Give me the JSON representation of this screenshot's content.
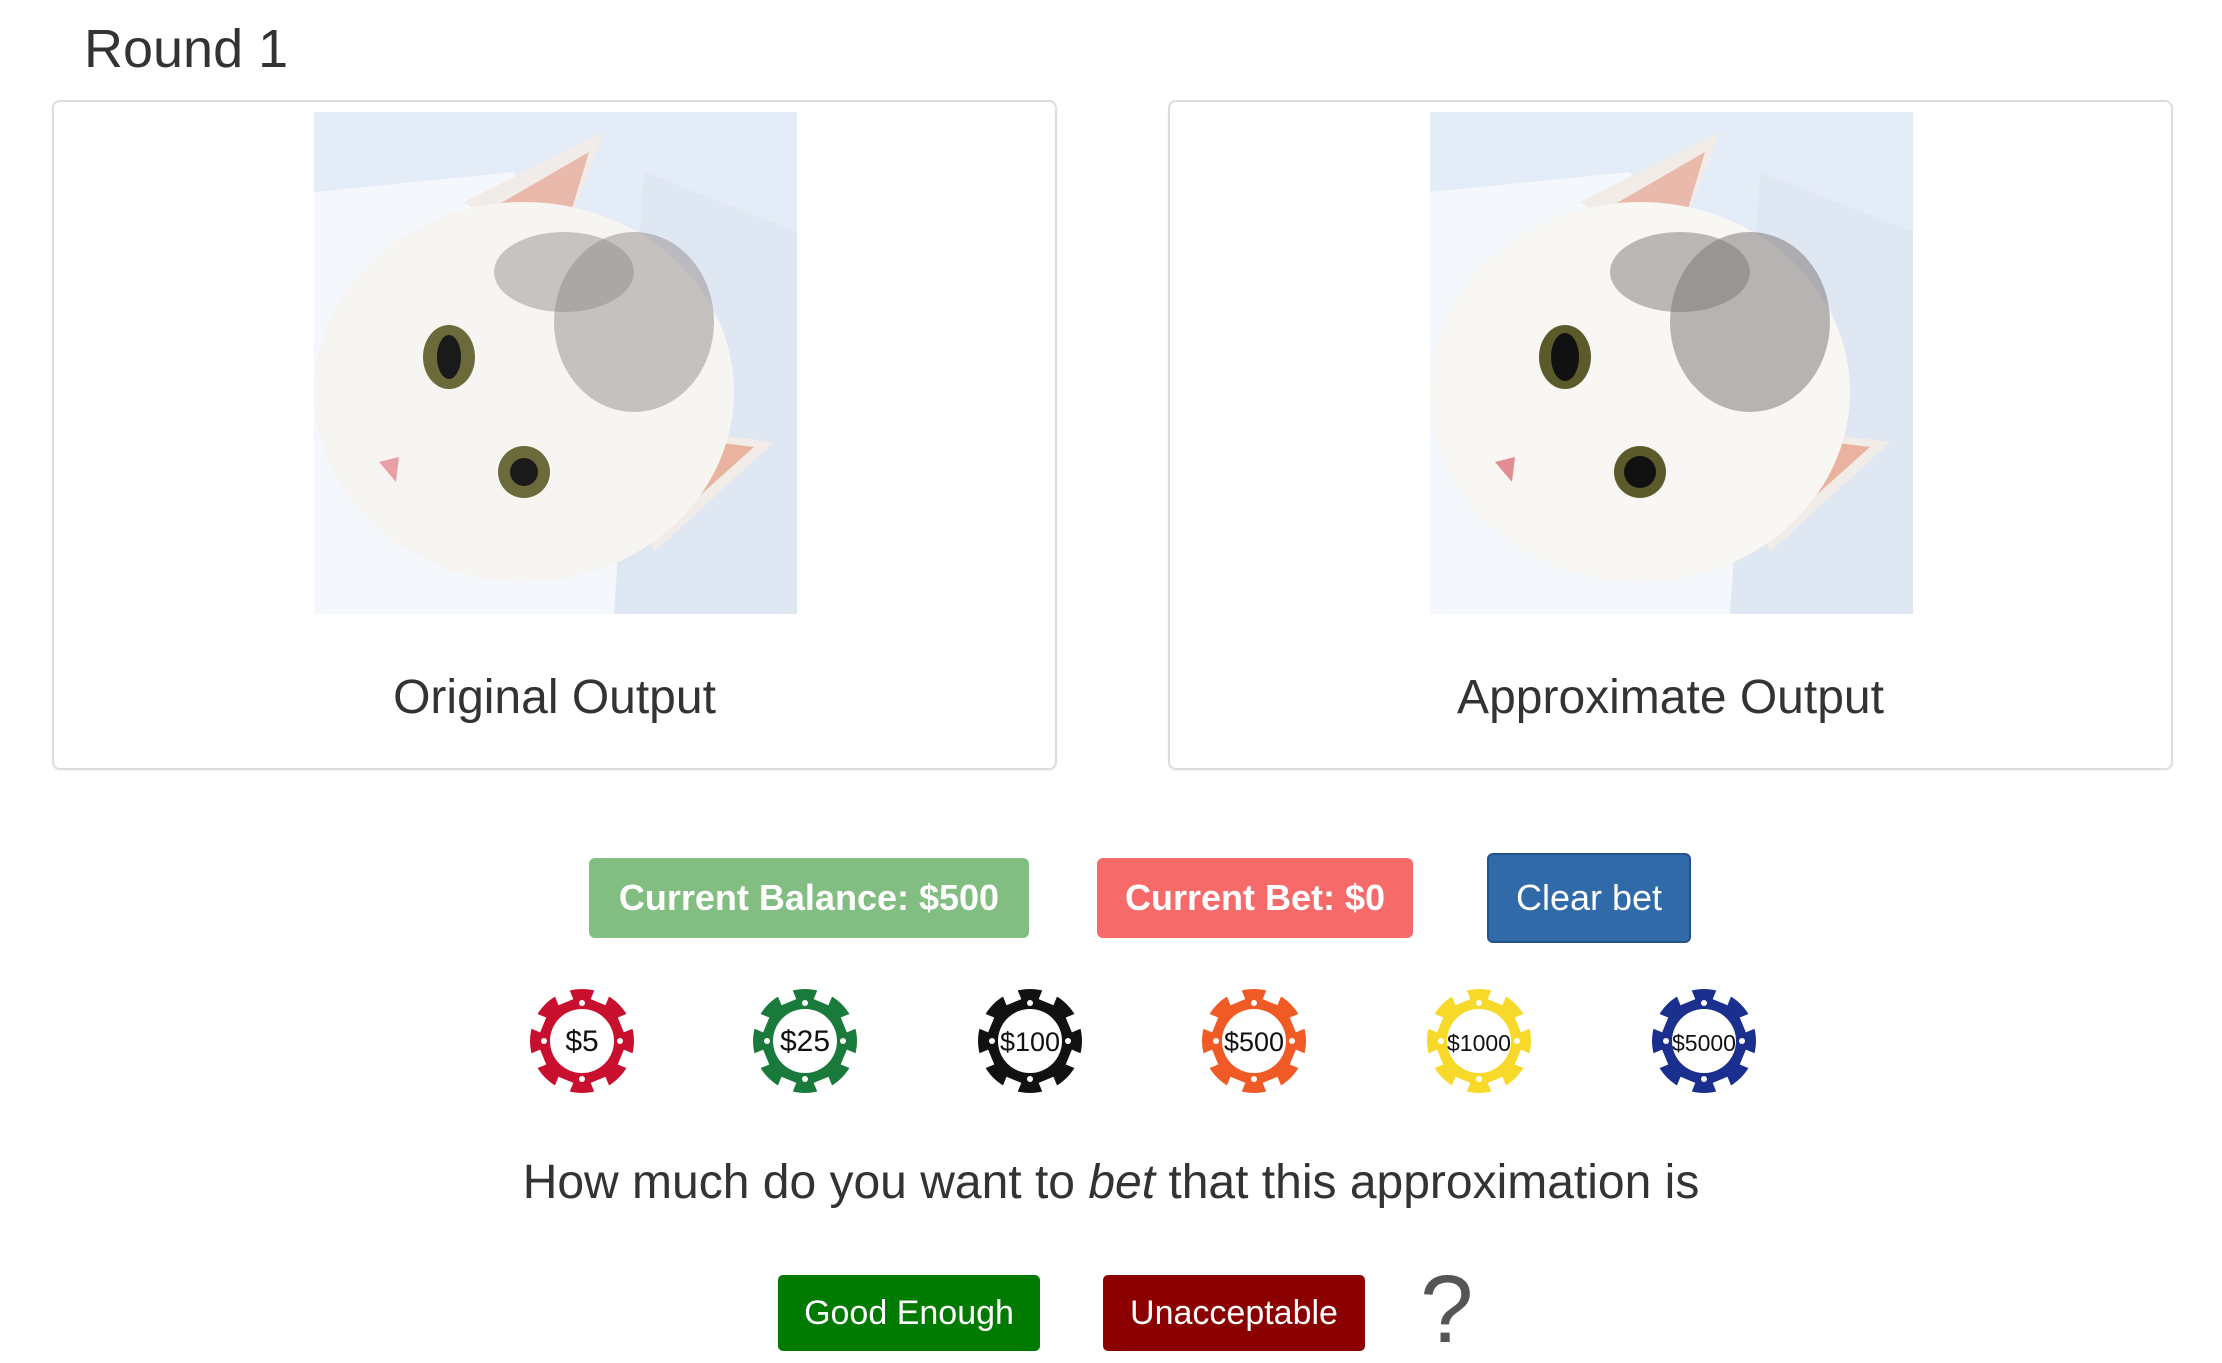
{
  "round": {
    "title": "Round 1"
  },
  "panels": {
    "original": {
      "caption": "Original Output"
    },
    "approximate": {
      "caption": "Approximate Output"
    }
  },
  "status": {
    "balance_label": "Current Balance:",
    "balance_value": "$500",
    "bet_label": "Current Bet:",
    "bet_value": "$0",
    "balance_color": "#82bd82",
    "bet_color": "#f76a6a"
  },
  "clear_button": {
    "label": "Clear bet",
    "color": "#306aa8"
  },
  "chips": [
    {
      "label": "$5",
      "color": "#c8102e"
    },
    {
      "label": "$25",
      "color": "#1a7a3c"
    },
    {
      "label": "$100",
      "color": "#111111"
    },
    {
      "label": "$500",
      "color": "#f05a24"
    },
    {
      "label": "$1000",
      "color": "#f7d92a"
    },
    {
      "label": "$5000",
      "color": "#1b2f8f"
    }
  ],
  "question": {
    "before": "How much do you want to ",
    "emphasis": "bet",
    "after": " that this approximation is"
  },
  "decisions": {
    "good_label": "Good Enough",
    "good_color": "#007a00",
    "bad_label": "Unacceptable",
    "bad_color": "#8b0000",
    "prompt_mark": "?"
  }
}
